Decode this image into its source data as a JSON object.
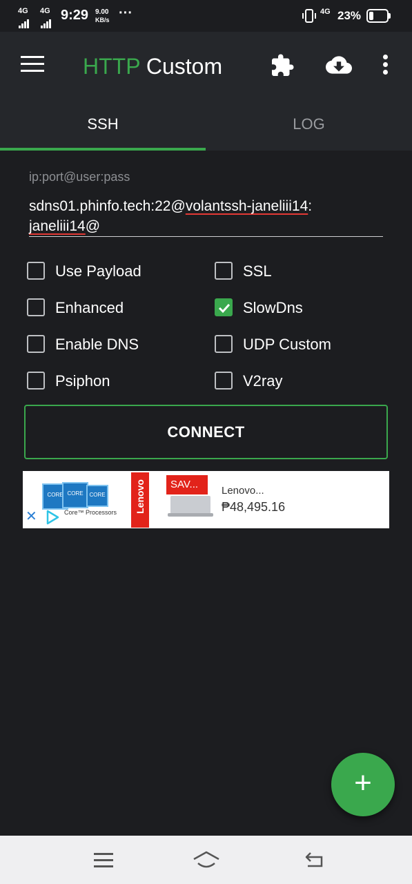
{
  "status_bar": {
    "net1": "4G",
    "net2": "4G",
    "time": "9:29",
    "speed_value": "9.00",
    "speed_unit": "KB/s",
    "dots": "···",
    "net3": "4G",
    "battery": "23%",
    "battery_level": 0.23
  },
  "app_bar": {
    "title_part1": "HTTP",
    "title_part2": "Custom",
    "icons": [
      "menu-icon",
      "puzzle-icon",
      "cloud-download-icon",
      "more-vert-icon"
    ]
  },
  "tabs": [
    {
      "label": "SSH",
      "selected": true
    },
    {
      "label": "LOG",
      "selected": false
    }
  ],
  "config": {
    "hint": "ip:port@user:pass",
    "value_part1": "sdns01.phinfo.tech:22@",
    "value_part2": "volantssh-janeliii14",
    "value_part3": ":",
    "value_part4": "janeliii14",
    "value_part5": "@"
  },
  "options": {
    "use_payload": {
      "label": "Use Payload",
      "checked": false
    },
    "ssl": {
      "label": "SSL",
      "checked": false
    },
    "enhanced": {
      "label": "Enhanced",
      "checked": false
    },
    "slowdns": {
      "label": "SlowDns",
      "checked": true
    },
    "enable_dns": {
      "label": "Enable DNS",
      "checked": false
    },
    "udp_custom": {
      "label": "UDP Custom",
      "checked": false
    },
    "psiphon": {
      "label": "Psiphon",
      "checked": false
    },
    "v2ray": {
      "label": "V2ray",
      "checked": false
    }
  },
  "connect_label": "CONNECT",
  "ad": {
    "chip_text": "CORE",
    "chip_brand": "intel",
    "caption": "Core™ Processors",
    "brand": "Lenovo",
    "badge": "SAV...",
    "product_name": "Lenovo...",
    "price": "₱48,495.16",
    "close": "✕"
  },
  "fab_label": "+",
  "colors": {
    "accent": "#3aa84d",
    "background": "#1c1d20",
    "app_bar": "#25272b",
    "underline_error": "#e53935"
  }
}
